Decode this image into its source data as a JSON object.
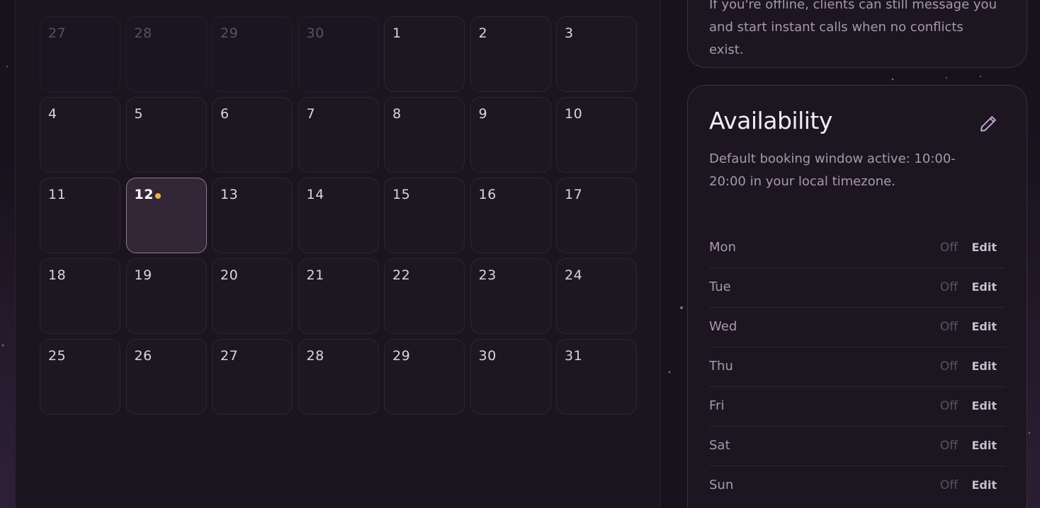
{
  "calendar": {
    "days": [
      {
        "label": "27",
        "muted": true
      },
      {
        "label": "28",
        "muted": true
      },
      {
        "label": "29",
        "muted": true
      },
      {
        "label": "30",
        "muted": true
      },
      {
        "label": "1"
      },
      {
        "label": "2"
      },
      {
        "label": "3"
      },
      {
        "label": "4"
      },
      {
        "label": "5"
      },
      {
        "label": "6"
      },
      {
        "label": "7"
      },
      {
        "label": "8"
      },
      {
        "label": "9"
      },
      {
        "label": "10"
      },
      {
        "label": "11"
      },
      {
        "label": "12",
        "today": true,
        "has_event_dot": true
      },
      {
        "label": "13"
      },
      {
        "label": "14"
      },
      {
        "label": "15"
      },
      {
        "label": "16"
      },
      {
        "label": "17"
      },
      {
        "label": "18"
      },
      {
        "label": "19"
      },
      {
        "label": "20"
      },
      {
        "label": "21"
      },
      {
        "label": "22"
      },
      {
        "label": "23"
      },
      {
        "label": "24"
      },
      {
        "label": "25"
      },
      {
        "label": "26"
      },
      {
        "label": "27"
      },
      {
        "label": "28"
      },
      {
        "label": "29"
      },
      {
        "label": "30"
      },
      {
        "label": "31"
      }
    ],
    "event_dot_color": "#f0b24a"
  },
  "top_card": {
    "text": "If you're offline, clients can still message you and start instant calls when no conflicts exist."
  },
  "availability": {
    "title": "Availability",
    "edit_icon": "pencil-icon",
    "description": "Default booking window active: 10:00-20:00 in your local timezone.",
    "schedule": [
      {
        "day": "Mon",
        "status": "Off",
        "action": "Edit"
      },
      {
        "day": "Tue",
        "status": "Off",
        "action": "Edit"
      },
      {
        "day": "Wed",
        "status": "Off",
        "action": "Edit"
      },
      {
        "day": "Thu",
        "status": "Off",
        "action": "Edit"
      },
      {
        "day": "Fri",
        "status": "Off",
        "action": "Edit"
      },
      {
        "day": "Sat",
        "status": "Off",
        "action": "Edit"
      },
      {
        "day": "Sun",
        "status": "Off",
        "action": "Edit"
      }
    ]
  }
}
